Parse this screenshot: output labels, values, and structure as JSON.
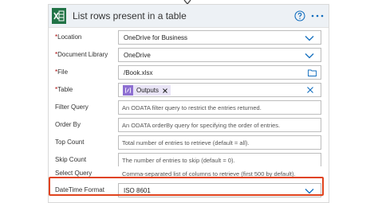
{
  "header": {
    "title": "List rows present in a table",
    "icon": "excel-icon",
    "accent": "#217346"
  },
  "fields": {
    "location": {
      "label": "Location",
      "required": "*",
      "value": "OneDrive for Business"
    },
    "document_library": {
      "label": "Document Library",
      "required": "*",
      "value": "OneDrive"
    },
    "file": {
      "label": "File",
      "required": "*",
      "value": "/Book.xlsx"
    },
    "table": {
      "label": "Table",
      "required": "*",
      "token": "Outputs"
    },
    "filter_query": {
      "label": "Filter Query",
      "placeholder": "An ODATA filter query to restrict the entries returned."
    },
    "order_by": {
      "label": "Order By",
      "placeholder": "An ODATA orderBy query for specifying the order of entries."
    },
    "top_count": {
      "label": "Top Count",
      "placeholder": "Total number of entries to retrieve (default = all)."
    },
    "skip_count": {
      "label": "Skip Count",
      "placeholder": "The number of entries to skip (default = 0)."
    },
    "select_query": {
      "label": "Select Query",
      "placeholder": "Comma-separated list of columns to retrieve (first 500 by default)."
    },
    "datetime_format": {
      "label": "DateTime Format",
      "value": "ISO 8601"
    }
  },
  "colors": {
    "highlight": "#e0431d",
    "chevron": "#0f6cbd",
    "token_bg": "#e9e4f6",
    "token_icon": "#8e6fd2",
    "required": "#a80000"
  }
}
